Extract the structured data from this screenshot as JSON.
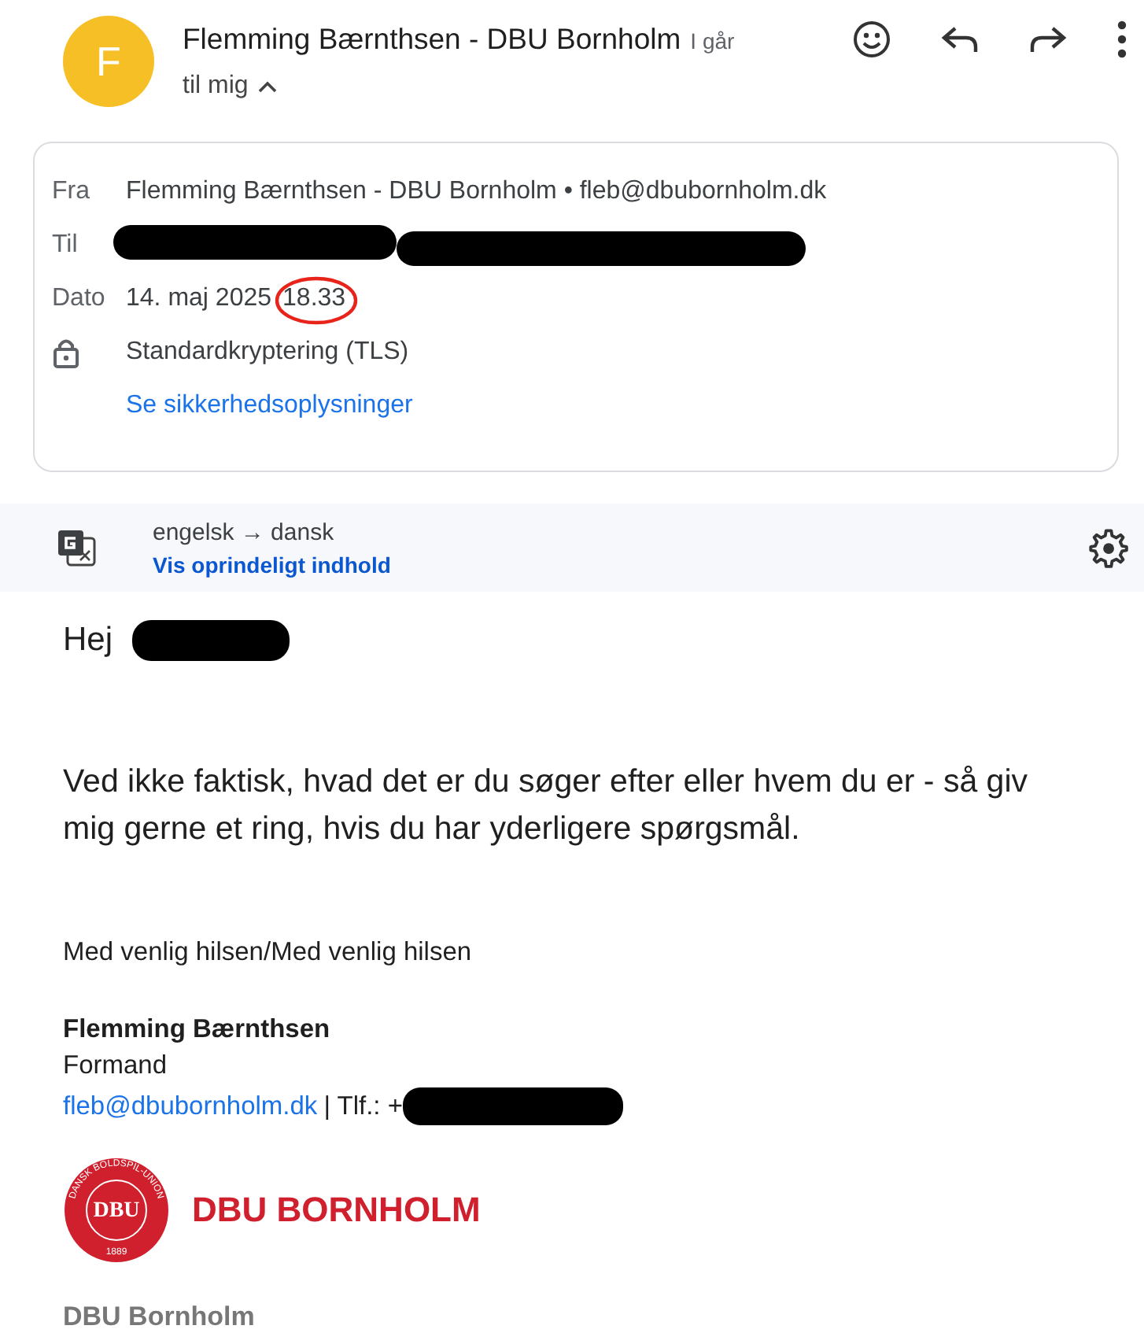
{
  "header": {
    "avatar_letter": "F",
    "sender": "Flemming Bærnthsen - DBU Bornholm",
    "time": "I går",
    "recipient_summary": "til mig",
    "expanded": true
  },
  "details": {
    "from_label": "Fra",
    "from_value": "Flemming Bærnthsen - DBU Bornholm • fleb@dbubornholm.dk",
    "to_label": "Til",
    "date_label": "Dato",
    "date": "14. maj 2025",
    "time": "18.33",
    "time_circled": true,
    "encryption": "Standardkryptering (TLS)",
    "security_link": "Se sikkerhedsoplysninger"
  },
  "translation": {
    "languages": "engelsk → dansk",
    "link": "Vis oprindeligt indhold"
  },
  "body": {
    "greeting": "Hej",
    "paragraph": "Ved ikke faktisk, hvad det er du søger efter eller hvem du er - så giv mig gerne et ring, hvis du har yderligere spørgsmål.",
    "closing": "Med venlig hilsen/Med venlig hilsen"
  },
  "signature": {
    "name": "Flemming Bærnthsen",
    "role": "Formand",
    "email": "fleb@dbubornholm.dk",
    "phone_label": "| Tlf.: +",
    "logo_initials": "DBU",
    "logo_ring": "DANSK BOLDSPIL-UNION",
    "logo_year": "1889",
    "logo_text": "DBU BORNHOLM",
    "org": "DBU Bornholm"
  }
}
